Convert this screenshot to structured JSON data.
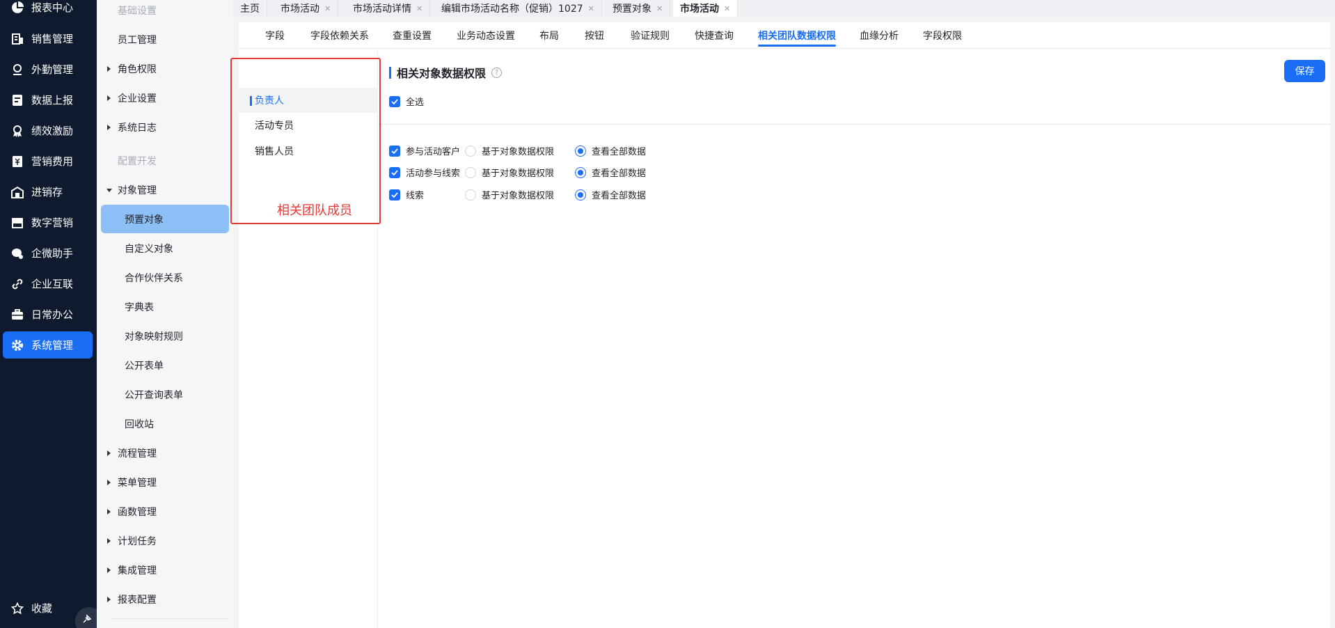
{
  "nav": {
    "items": [
      {
        "label": "报表中心",
        "icon": "pie-chart-icon"
      },
      {
        "label": "销售管理",
        "icon": "building-icon"
      },
      {
        "label": "外勤管理",
        "icon": "location-pin-icon"
      },
      {
        "label": "数据上报",
        "icon": "report-upload-icon"
      },
      {
        "label": "绩效激励",
        "icon": "medal-icon"
      },
      {
        "label": "营销费用",
        "icon": "expense-icon"
      },
      {
        "label": "进销存",
        "icon": "warehouse-icon"
      },
      {
        "label": "数字营销",
        "icon": "storefront-icon"
      },
      {
        "label": "企微助手",
        "icon": "chat-bubbles-icon"
      },
      {
        "label": "企业互联",
        "icon": "link-icon"
      },
      {
        "label": "日常办公",
        "icon": "briefcase-icon"
      },
      {
        "label": "系统管理",
        "icon": "gear-icon"
      }
    ],
    "favorites": "收藏",
    "active_color": "#1a6ef5"
  },
  "sidebar": {
    "basic_settings": "基础设置",
    "employee_mgmt": "员工管理",
    "role_permission": "角色权限",
    "enterprise_settings": "企业设置",
    "system_log": "系统日志",
    "config_dev": "配置开发",
    "object_mgmt": "对象管理",
    "preset_object": "预置对象",
    "custom_object": "自定义对象",
    "partner_relation": "合作伙伴关系",
    "dictionary": "字典表",
    "object_mapping": "对象映射规则",
    "public_form": "公开表单",
    "public_query_form": "公开查询表单",
    "recycle_bin": "回收站",
    "process_mgmt": "流程管理",
    "menu_mgmt": "菜单管理",
    "function_mgmt": "函数管理",
    "scheduled_task": "计划任务",
    "integration_mgmt": "集成管理",
    "report_config": "报表配置"
  },
  "tabs": [
    {
      "label": "主页",
      "closable": false
    },
    {
      "label": "市场活动",
      "closable": true
    },
    {
      "label": "市场活动详情",
      "closable": true
    },
    {
      "label": "编辑市场活动名称（促销）1027",
      "closable": true
    },
    {
      "label": "预置对象",
      "closable": true
    },
    {
      "label": "市场活动",
      "closable": true,
      "active": true
    }
  ],
  "subtabs": [
    "字段",
    "字段依赖关系",
    "查重设置",
    "业务动态设置",
    "布局",
    "按钮",
    "验证规则",
    "快捷查询",
    "相关团队数据权限",
    "血缘分析",
    "字段权限"
  ],
  "roles": [
    "负责人",
    "活动专员",
    "销售人员"
  ],
  "annotation": "相关团队成员",
  "panel": {
    "title": "相关对象数据权限",
    "help": "?",
    "save": "保存",
    "select_all": "全选",
    "rows": [
      {
        "name": "参与活动客户",
        "opt_a": "基于对象数据权限",
        "opt_b": "查看全部数据",
        "checked": true,
        "selected": "b"
      },
      {
        "name": "活动参与线索",
        "opt_a": "基于对象数据权限",
        "opt_b": "查看全部数据",
        "checked": true,
        "selected": "b"
      },
      {
        "name": "线索",
        "opt_a": "基于对象数据权限",
        "opt_b": "查看全部数据",
        "checked": true,
        "selected": "b"
      }
    ]
  }
}
